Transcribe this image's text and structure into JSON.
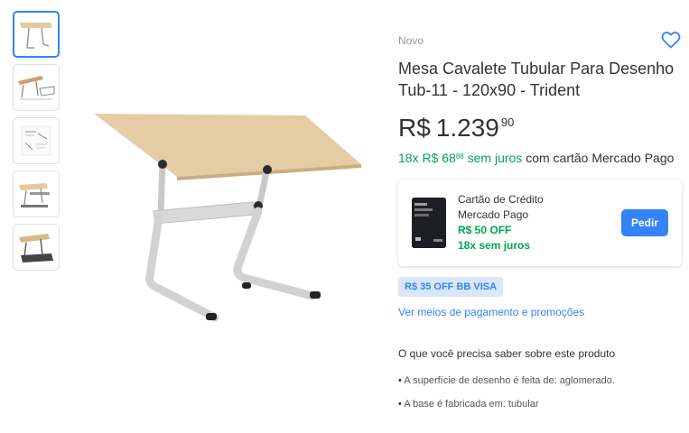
{
  "gallery": {
    "thumbnails": [
      {
        "alt": "mesa-vista-lateral",
        "selected": true
      },
      {
        "alt": "mesa-dimensoes",
        "selected": false
      },
      {
        "alt": "manual-montagem",
        "selected": false
      },
      {
        "alt": "mesa-com-regua",
        "selected": false
      },
      {
        "alt": "mesa-base-preta",
        "selected": false
      }
    ]
  },
  "product": {
    "condition": "Novo",
    "title": "Mesa Cavalete Tubular Para Desenho Tub-11 - 120x90 - Trident",
    "price": {
      "currency": "R$",
      "amount": "1.239",
      "cents": "90"
    },
    "installments": {
      "count_label": "18x R$ 68",
      "cents": "88",
      "no_interest": "sem juros",
      "rest": "com cartão Mercado Pago"
    }
  },
  "credit_card_offer": {
    "title_line1": "Cartão de Crédito",
    "title_line2": "Mercado Pago",
    "discount": "R$ 50 OFF",
    "installments": "18x sem juros",
    "button_label": "Pedir"
  },
  "promo_badge": "R$ 35 OFF BB VISA",
  "payments_link": "Ver meios de pagamento e promoções",
  "features": {
    "title": "O que você precisa saber sobre este produto",
    "items": [
      "A superfície de desenho é feita de: aglomerado.",
      "A base é fabricada em: tubular"
    ]
  },
  "colors": {
    "accent": "#3483fa",
    "green": "#00a650",
    "badge_bg": "#d9e7fa"
  },
  "icons": [
    "heart-icon"
  ]
}
